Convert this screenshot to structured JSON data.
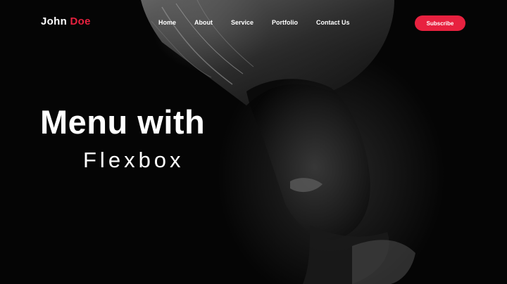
{
  "header": {
    "logo_first": "John",
    "logo_accent": "Doe",
    "nav_items": [
      "Home",
      "About",
      "Service",
      "Portfolio",
      "Contact Us"
    ],
    "subscribe_label": "Subscribe"
  },
  "hero": {
    "title_line1": "Menu with",
    "title_line2": "Flexbox"
  },
  "colors": {
    "accent": "#e8213f",
    "background": "#050505",
    "text": "#ffffff"
  }
}
